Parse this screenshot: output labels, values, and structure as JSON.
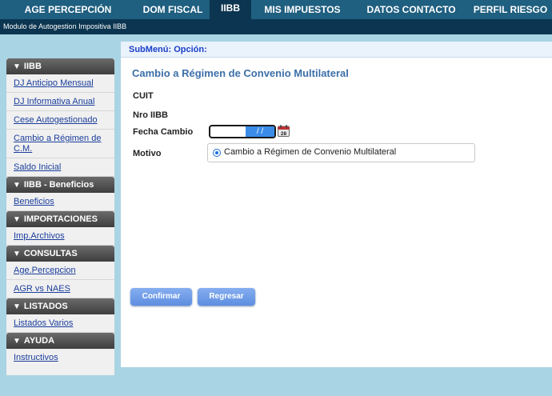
{
  "nav": {
    "tabs": [
      "AGE PERCEPCIÓN",
      "DOM FISCAL",
      "IIBB",
      "MIS IMPUESTOS",
      "DATOS CONTACTO",
      "PERFIL RIESGO"
    ],
    "active_tab": "IIBB",
    "subtitle": "Modulo de Autogestion Impositiva IIBB"
  },
  "sidebar": {
    "sections": [
      {
        "title": "IIBB",
        "items": [
          "DJ Anticipo Mensual",
          "DJ Informativa Anual",
          "Cese Autogestionado",
          "Cambio a Régimen de C.M.",
          "Saldo Inicial"
        ]
      },
      {
        "title": "IIBB - Beneficios",
        "items": [
          "Beneficios"
        ]
      },
      {
        "title": "IMPORTACIONES",
        "items": [
          "Imp.Archivos"
        ]
      },
      {
        "title": "CONSULTAS",
        "items": [
          "Age.Percepcion",
          "AGR vs NAES"
        ]
      },
      {
        "title": "LISTADOS",
        "items": [
          "Listados Varios"
        ]
      },
      {
        "title": "AYUDA",
        "items": [
          "Instructivos"
        ]
      }
    ]
  },
  "main": {
    "submenu": "SubMenú: Opción:",
    "title": "Cambio a Régimen de Convenio Multilateral",
    "labels": {
      "cuit": "CUIT",
      "nro_iibb": "Nro IIBB",
      "fecha_cambio": "Fecha Cambio",
      "motivo": "Motivo"
    },
    "date_value": "/ /",
    "motivo_option": "Cambio a Régimen de Convenio Multilateral",
    "buttons": {
      "confirm": "Confirmar",
      "reset": "Regresar"
    }
  },
  "colors": {
    "nav_bg": "#1f5f80",
    "nav_active": "#0b3550",
    "page_bg": "#a9d4e4",
    "button": "#6f9ae6",
    "link": "#1a3e9c"
  }
}
